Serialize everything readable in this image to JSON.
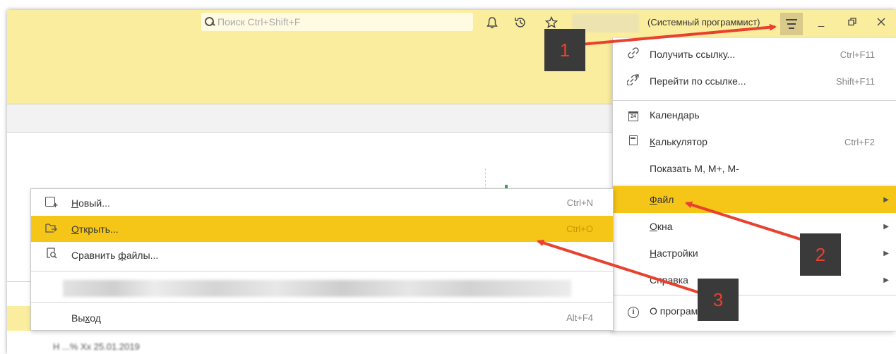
{
  "topbar": {
    "search_placeholder": "Поиск Ctrl+Shift+F",
    "system_label": "(Системный программист)",
    "icons": [
      "bell-icon",
      "history-icon",
      "star-icon",
      "main-menu-icon"
    ]
  },
  "main_menu": {
    "items": [
      {
        "icon": "link-icon",
        "label": "Получить ссылку...",
        "shortcut": "Ctrl+F11"
      },
      {
        "icon": "goto-link-icon",
        "label": "Перейти по ссылке...",
        "shortcut": "Shift+F11"
      },
      {
        "icon": "calendar-icon",
        "icon_text": "24",
        "label": "Календарь",
        "shortcut": ""
      },
      {
        "icon": "calculator-icon",
        "label": "Калькулятор",
        "shortcut": "Ctrl+F2"
      },
      {
        "icon": "",
        "label": "Показать M, M+, M-",
        "shortcut": ""
      },
      {
        "icon": "",
        "label": "Файл",
        "shortcut": "",
        "submenu": true,
        "active": true
      },
      {
        "icon": "",
        "label": "Окна",
        "shortcut": "",
        "submenu": true
      },
      {
        "icon": "",
        "label": "Настройки",
        "shortcut": "",
        "submenu": true
      },
      {
        "icon": "",
        "label": "Справка",
        "shortcut": "",
        "submenu": true
      },
      {
        "icon": "info-icon",
        "label": "О программе...",
        "shortcut": ""
      }
    ]
  },
  "file_menu": {
    "items": [
      {
        "icon": "new-file-icon",
        "label": "Новый...",
        "shortcut": "Ctrl+N"
      },
      {
        "icon": "open-file-icon",
        "label": "Открыть...",
        "shortcut": "Ctrl+O",
        "active": true
      },
      {
        "icon": "compare-files-icon",
        "label": "Сравнить файлы...",
        "shortcut": ""
      },
      {
        "icon": "",
        "label": "Выход",
        "shortcut": "Alt+F4"
      }
    ]
  },
  "background": {
    "bottom_text": "Н                          ...%           Хх             25.01.2019"
  },
  "annotations": {
    "step1": "1",
    "step2": "2",
    "step3": "3",
    "arrow_color": "#e8412e",
    "label_bg": "#3a3a3a"
  },
  "colors": {
    "toolbar_yellow": "#fbed9e",
    "highlight_yellow": "#f5c518"
  }
}
